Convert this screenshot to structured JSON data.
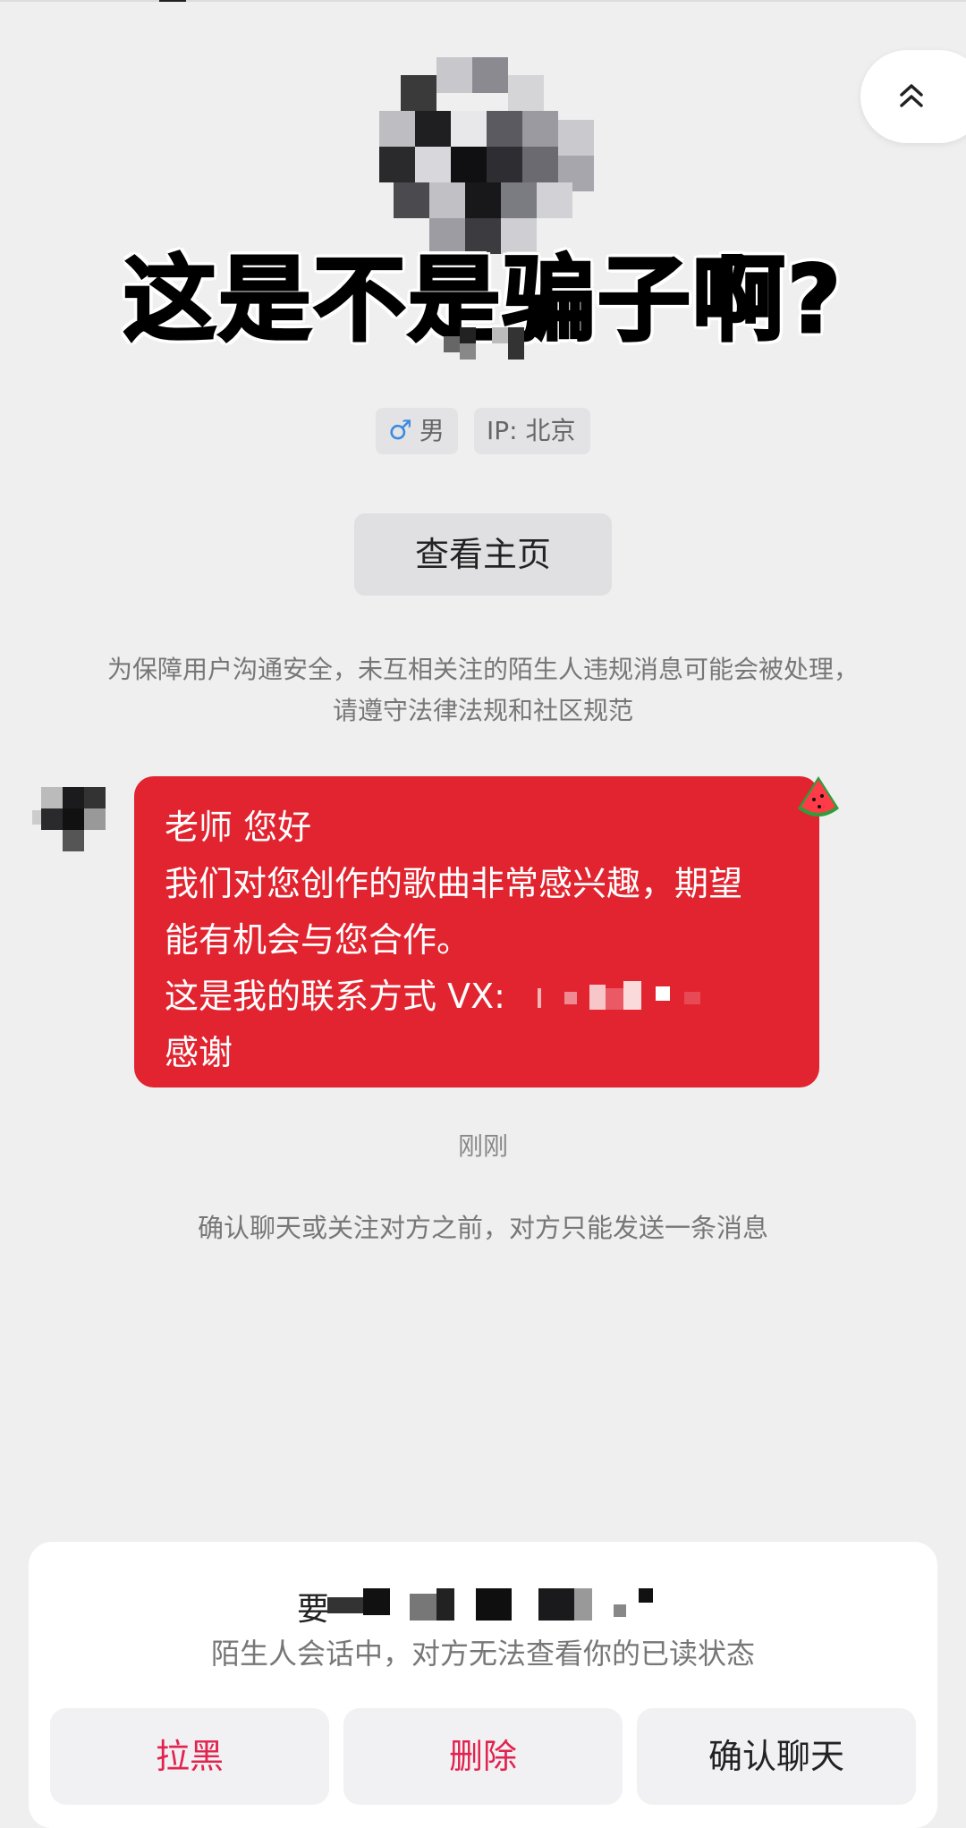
{
  "overlay_caption": "这是不是骗子啊?",
  "profile": {
    "gender_symbol": "♂",
    "gender_label": "男",
    "ip_label": "IP: 北京",
    "view_home_label": "查看主页"
  },
  "safety_notice": "为保障用户沟通安全，未互相关注的陌生人违规消息可能会被处理，请遵守法律法规和社区规范",
  "message": {
    "lines": [
      "老师 您好",
      "我们对您创作的歌曲非常感兴趣，期望",
      "能有机会与您合作。",
      "这是我的联系方式 VX:",
      "感谢"
    ],
    "timestamp": "刚刚"
  },
  "limit_note": "确认聊天或关注对方之前，对方只能发送一条消息",
  "bottom_sheet": {
    "title_prefix": "要",
    "subtitle": "陌生人会话中，对方无法查看你的已读状态",
    "buttons": {
      "block": "拉黑",
      "delete": "删除",
      "confirm": "确认聊天"
    }
  },
  "colors": {
    "bubble_bg": "#e1242f",
    "danger_text": "#e1244f",
    "page_bg": "#efeff0",
    "male_icon": "#3a8be0"
  },
  "icons": [
    "chevron-double-up-icon",
    "male-icon",
    "watermelon-sticker-icon"
  ]
}
